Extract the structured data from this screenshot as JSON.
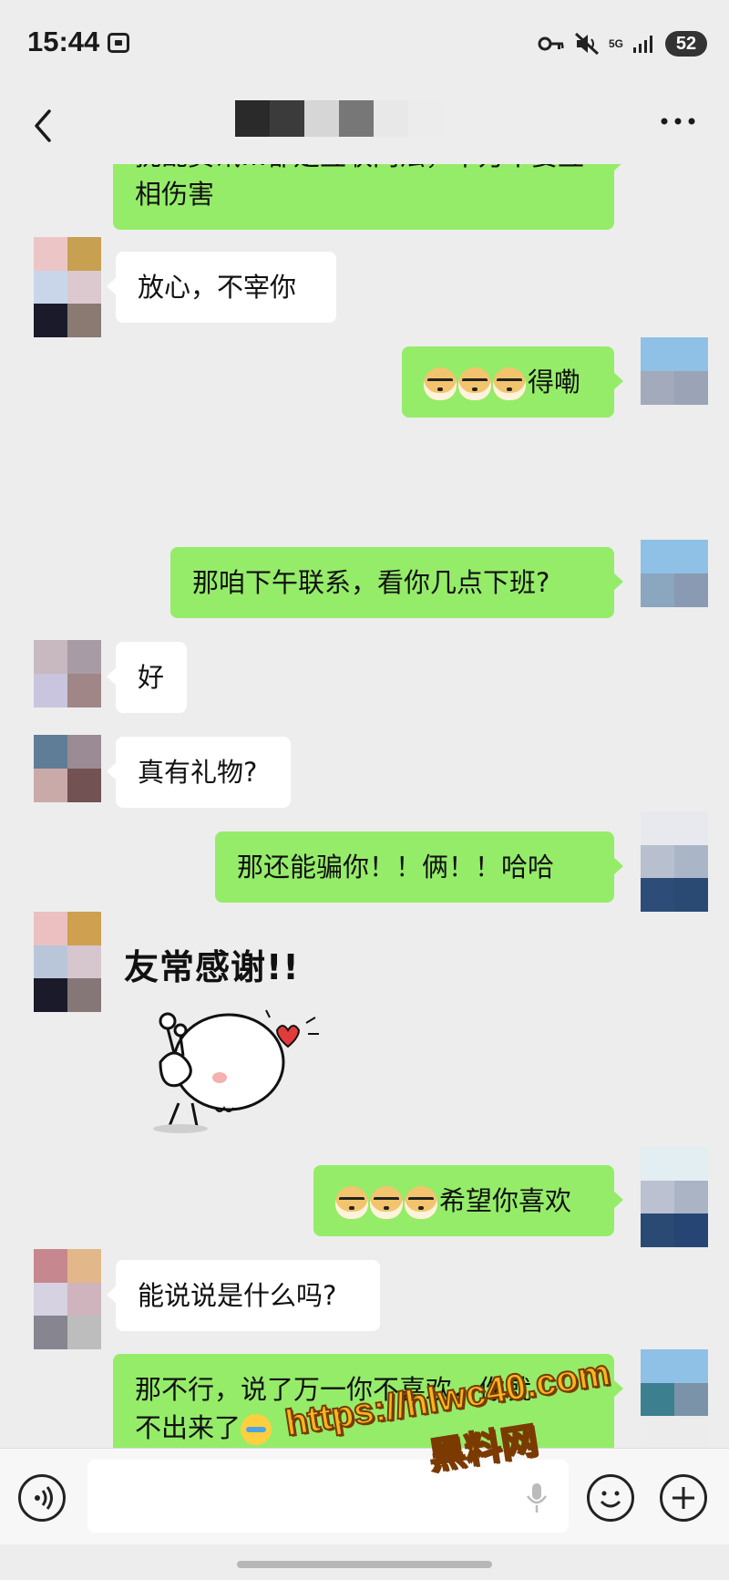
{
  "status_bar": {
    "time": "15:44",
    "network": "5G",
    "battery": "52"
  },
  "nav": {
    "title_redacted": true
  },
  "messages": [
    {
      "id": "m0",
      "side": "out",
      "text": "相伤害",
      "partial_text_above": "扰乱资讯…都是互联网法，千万不要互"
    },
    {
      "id": "m1",
      "side": "in",
      "text": "放心，不宰你"
    },
    {
      "id": "m2",
      "side": "out",
      "emoji": [
        "doge",
        "doge",
        "doge"
      ],
      "text": "得嘞"
    },
    {
      "id": "m3",
      "side": "out",
      "text": "那咱下午联系，看你几点下班?"
    },
    {
      "id": "m4",
      "side": "in",
      "text": "好"
    },
    {
      "id": "m5",
      "side": "in",
      "text": "真有礼物?"
    },
    {
      "id": "m6",
      "side": "out",
      "text": "那还能骗你！！俩！！哈哈"
    },
    {
      "id": "m7",
      "side": "in",
      "sticker": true,
      "text": "友常感谢!!"
    },
    {
      "id": "m8",
      "side": "out",
      "emoji": [
        "doge",
        "doge",
        "doge"
      ],
      "text": "希望你喜欢"
    },
    {
      "id": "m9",
      "side": "in",
      "text": "能说说是什么吗?"
    },
    {
      "id": "m10",
      "side": "out",
      "text_line1": "那不行，说了万一你不喜欢，你就",
      "text_line2": "不出来了",
      "trailing_emoji": "facepalm"
    }
  ],
  "input": {
    "placeholder": ""
  },
  "watermark": {
    "line1": "https://hlwc40.com",
    "line2": "黑料网"
  },
  "colors": {
    "outgoing_bubble": "#95ec69",
    "incoming_bubble": "#ffffff",
    "background": "#ededed",
    "watermark": "#f7b51f"
  }
}
